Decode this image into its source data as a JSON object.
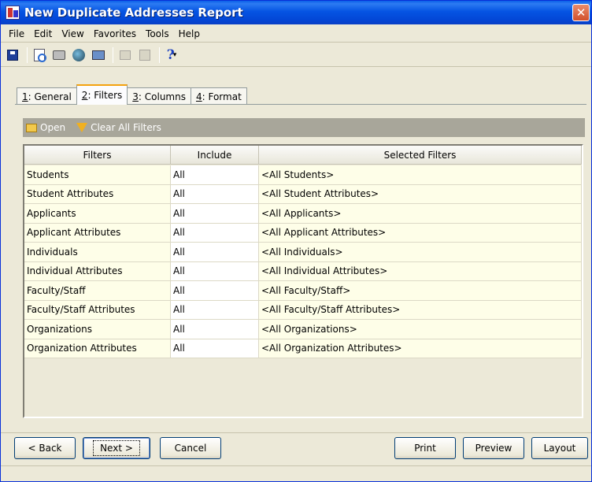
{
  "window": {
    "title": "New Duplicate Addresses Report",
    "close_glyph": "✕"
  },
  "menu": [
    "File",
    "Edit",
    "View",
    "Favorites",
    "Tools",
    "Help"
  ],
  "toolbar": {
    "help_glyph": "?",
    "dropdown_glyph": "▾"
  },
  "tabs": [
    {
      "key": "1",
      "label": ": General"
    },
    {
      "key": "2",
      "label": ": Filters"
    },
    {
      "key": "3",
      "label": ": Columns"
    },
    {
      "key": "4",
      "label": ": Format"
    }
  ],
  "actions": {
    "open": "Open",
    "clear_all": "Clear All Filters"
  },
  "grid": {
    "headers": [
      "Filters",
      "Include",
      "Selected Filters"
    ],
    "rows": [
      [
        "Students",
        "All",
        "<All Students>"
      ],
      [
        "Student Attributes",
        "All",
        "<All Student Attributes>"
      ],
      [
        "Applicants",
        "All",
        "<All Applicants>"
      ],
      [
        "Applicant Attributes",
        "All",
        "<All Applicant Attributes>"
      ],
      [
        "Individuals",
        "All",
        "<All Individuals>"
      ],
      [
        "Individual Attributes",
        "All",
        "<All Individual Attributes>"
      ],
      [
        "Faculty/Staff",
        "All",
        "<All Faculty/Staff>"
      ],
      [
        "Faculty/Staff Attributes",
        "All",
        "<All Faculty/Staff Attributes>"
      ],
      [
        "Organizations",
        "All",
        "<All Organizations>"
      ],
      [
        "Organization Attributes",
        "All",
        "<All Organization Attributes>"
      ]
    ]
  },
  "buttons": {
    "back": "< Back",
    "next": "Next >",
    "cancel": "Cancel",
    "print": "Print",
    "preview": "Preview",
    "layout": "Layout"
  }
}
